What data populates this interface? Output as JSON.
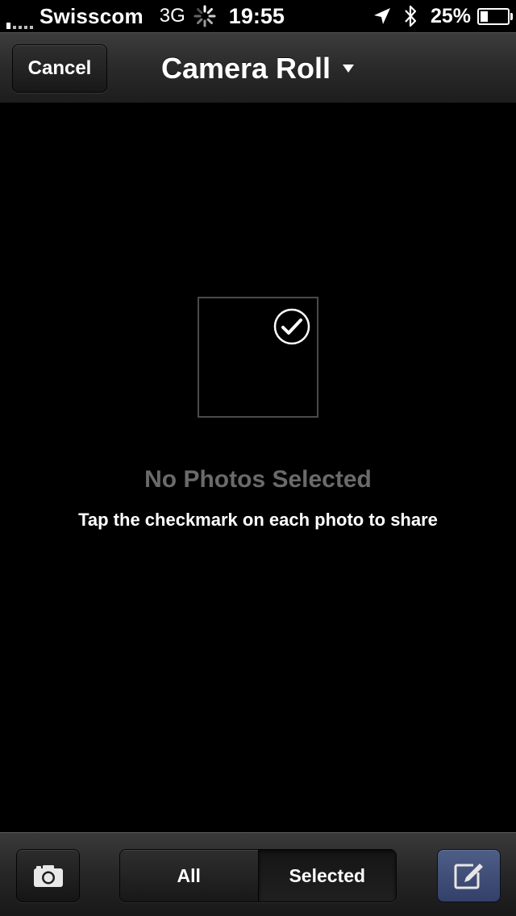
{
  "status_bar": {
    "carrier": "Swisscom",
    "network": "3G",
    "time": "19:55",
    "battery_percent": "25%",
    "battery_level": 0.25,
    "icons": [
      "signal-icon",
      "activity-spinner-icon",
      "location-arrow-icon",
      "bluetooth-icon",
      "battery-icon"
    ]
  },
  "nav": {
    "cancel_label": "Cancel",
    "title": "Camera Roll",
    "title_icon": "chevron-down-icon"
  },
  "empty_state": {
    "icon": "checkmark-circle-icon",
    "title": "No Photos Selected",
    "subtitle": "Tap the checkmark on each photo to share"
  },
  "toolbar": {
    "camera_icon": "camera-icon",
    "segments": [
      "All",
      "Selected"
    ],
    "selected_segment": "Selected",
    "compose_icon": "compose-icon",
    "compose_color": "#42507a"
  }
}
